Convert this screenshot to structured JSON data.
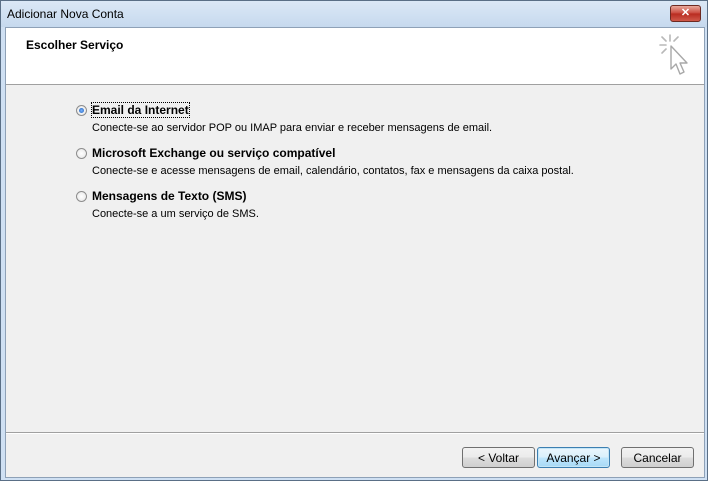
{
  "window": {
    "title": "Adicionar Nova Conta",
    "close_glyph": "✕"
  },
  "header": {
    "title": "Escolher Serviço",
    "icon": "cursor-click-icon"
  },
  "options": [
    {
      "label": "Email da Internet",
      "description": "Conecte-se ao servidor POP ou IMAP para enviar e receber mensagens de email.",
      "selected": true
    },
    {
      "label": "Microsoft Exchange ou serviço compatível",
      "description": "Conecte-se e acesse mensagens de email, calendário, contatos, fax e mensagens da caixa postal.",
      "selected": false
    },
    {
      "label": "Mensagens de Texto (SMS)",
      "description": "Conecte-se a um serviço de SMS.",
      "selected": false
    }
  ],
  "buttons": {
    "back": "< Voltar",
    "next": "Avançar >",
    "cancel": "Cancelar"
  }
}
